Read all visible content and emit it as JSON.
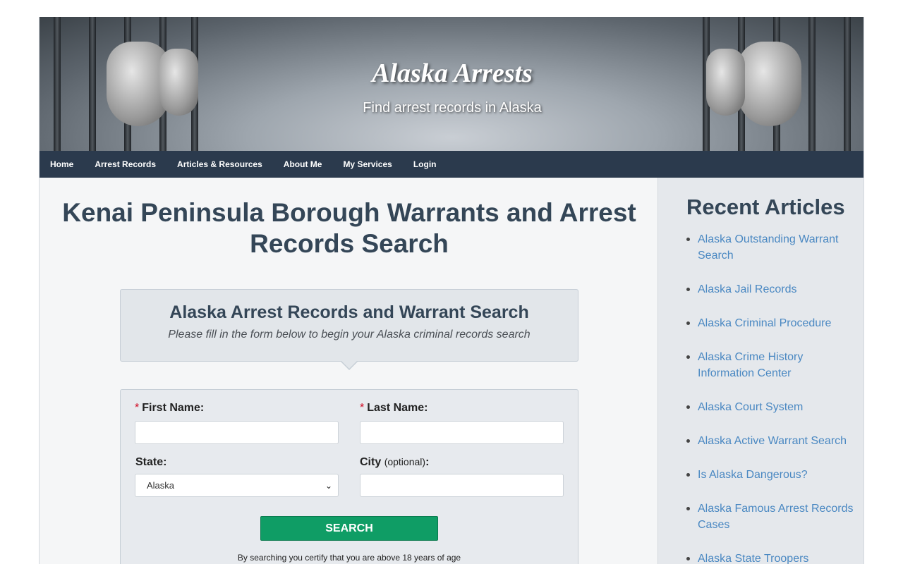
{
  "banner": {
    "title": "Alaska Arrests",
    "subtitle": "Find arrest records in Alaska"
  },
  "nav": {
    "items": [
      "Home",
      "Arrest Records",
      "Articles & Resources",
      "About Me",
      "My Services",
      "Login"
    ]
  },
  "main": {
    "title": "Kenai Peninsula Borough Warrants and Arrest Records Search",
    "search_box": {
      "heading": "Alaska Arrest Records and Warrant Search",
      "subheading": "Please fill in the form below to begin your Alaska criminal records search"
    },
    "form": {
      "required_mark": "*",
      "first_name_label": "First Name:",
      "last_name_label": "Last Name:",
      "state_label": "State:",
      "city_label": "City",
      "city_optional": "(optional)",
      "city_colon": ":",
      "state_value": "Alaska",
      "first_name_value": "",
      "last_name_value": "",
      "city_value": "",
      "search_button": "SEARCH",
      "certify_text": "By searching you certify that you are above 18 years of age"
    }
  },
  "sidebar": {
    "title": "Recent Articles",
    "articles": [
      "Alaska Outstanding Warrant Search",
      "Alaska Jail Records",
      "Alaska Criminal Procedure",
      "Alaska Crime History Information Center",
      "Alaska Court System",
      "Alaska Active Warrant Search",
      "Is Alaska Dangerous?",
      "Alaska Famous Arrest Records Cases",
      "Alaska State Troopers"
    ]
  },
  "colors": {
    "nav_bg": "#2b3a4d",
    "title": "#344657",
    "link": "#4a88c2",
    "button": "#0f9d65"
  }
}
